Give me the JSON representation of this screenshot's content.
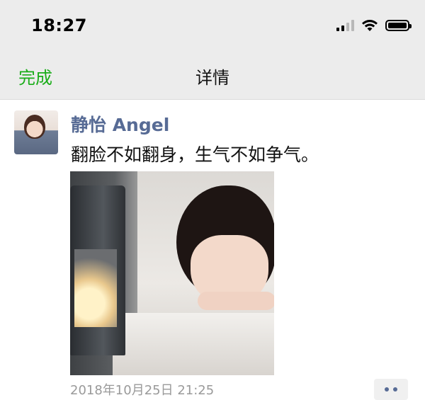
{
  "status_bar": {
    "time": "18:27",
    "icons": [
      "signal-icon",
      "wifi-icon",
      "battery-icon"
    ]
  },
  "nav": {
    "done_label": "完成",
    "title": "详情"
  },
  "post": {
    "username": "静怡 Angel",
    "text": "翻脸不如翻身，生气不如争气。",
    "timestamp": "2018年10月25日 21:25",
    "more_icon": "more-dots-icon"
  },
  "colors": {
    "accent_green": "#1aad19",
    "username_blue": "#576b95",
    "bar_bg": "#ececec"
  }
}
